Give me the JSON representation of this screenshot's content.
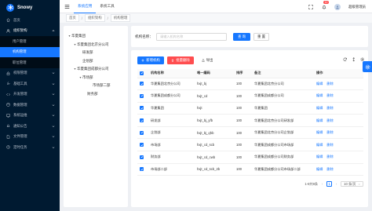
{
  "app": {
    "name": "Snowy"
  },
  "sidebar": {
    "items": [
      {
        "label": "首页",
        "icon": "home-icon"
      },
      {
        "label": "组织架构",
        "icon": "team-icon",
        "open": true,
        "children": [
          {
            "label": "用户管理",
            "active": false
          },
          {
            "label": "机构管理",
            "active": true
          },
          {
            "label": "职位管理",
            "active": false
          }
        ]
      },
      {
        "label": "权限管理",
        "icon": "lock-icon"
      },
      {
        "label": "基础工具",
        "icon": "tool-icon"
      },
      {
        "label": "开发管理",
        "icon": "code-icon"
      },
      {
        "label": "数据管理",
        "icon": "database-icon"
      },
      {
        "label": "系统运维",
        "icon": "monitor-icon"
      },
      {
        "label": "通知公告",
        "icon": "bell-icon"
      },
      {
        "label": "文件管理",
        "icon": "file-icon"
      },
      {
        "label": "定时任务",
        "icon": "clock-icon"
      }
    ]
  },
  "topbar": {
    "tabs": [
      {
        "label": "系统应用",
        "active": true
      },
      {
        "label": "系统工具",
        "active": false
      }
    ],
    "notification_count": "12",
    "username": "超级管理员"
  },
  "breadcrumb": {
    "items": [
      "首页",
      "组织架构",
      "机构管理"
    ]
  },
  "tree": {
    "nodes": [
      {
        "label": "华夏集团",
        "level": 0,
        "expanded": true
      },
      {
        "label": "华夏集团北京分公司",
        "level": 1,
        "expanded": true
      },
      {
        "label": "研发部",
        "level": 2
      },
      {
        "label": "企划部",
        "level": 2
      },
      {
        "label": "华夏集团成都分公司",
        "level": 1,
        "expanded": true
      },
      {
        "label": "市场部",
        "level": 2,
        "expanded": true
      },
      {
        "label": "市场部二部",
        "level": 3
      },
      {
        "label": "财务部",
        "level": 2
      }
    ]
  },
  "search": {
    "label": "机构名称：",
    "placeholder": "请输入机构名称",
    "value": "",
    "query_label": "查 询",
    "reset_label": "重 置"
  },
  "toolbar": {
    "add_label": "新增机构",
    "batch_delete_label": "批量删除",
    "export_label": "导出"
  },
  "table": {
    "columns": [
      "机构名称",
      "唯一编码",
      "排序",
      "备注",
      "操作"
    ],
    "rows": [
      {
        "name": "华夏集团北京分公司",
        "code": "hxjt_bj",
        "sort": "100",
        "remark": "华夏集团北京分公司"
      },
      {
        "name": "华夏集团成都分公司",
        "code": "hxjt_cd",
        "sort": "100",
        "remark": "华夏集团成都分公司"
      },
      {
        "name": "华夏集团",
        "code": "hxjt",
        "sort": "100",
        "remark": "华夏集团"
      },
      {
        "name": "研发部",
        "code": "hxjt_bj_yfb",
        "sort": "100",
        "remark": "华夏集团北京分公司研发部"
      },
      {
        "name": "企划部",
        "code": "hxjt_bj_qhb",
        "sort": "100",
        "remark": "华夏集团北京分公司企划部"
      },
      {
        "name": "市场部",
        "code": "hxjt_cd_scb",
        "sort": "100",
        "remark": "华夏集团成都分公司市场部"
      },
      {
        "name": "财务部",
        "code": "hxjt_cd_cwb",
        "sort": "100",
        "remark": "华夏集团成都分公司财务部"
      },
      {
        "name": "市场部二部",
        "code": "hxjt_cd_scb_2b",
        "sort": "100",
        "remark": "华夏集团成都分公司市场部二部"
      }
    ],
    "action_edit": "编辑",
    "action_delete": "删除"
  },
  "pagination": {
    "summary": "1-8共8条",
    "current_page": "1",
    "page_size": "10 条/页"
  },
  "colors": {
    "primary": "#1677ff",
    "danger": "#ff4d4f",
    "sidebar": "#001a31"
  }
}
